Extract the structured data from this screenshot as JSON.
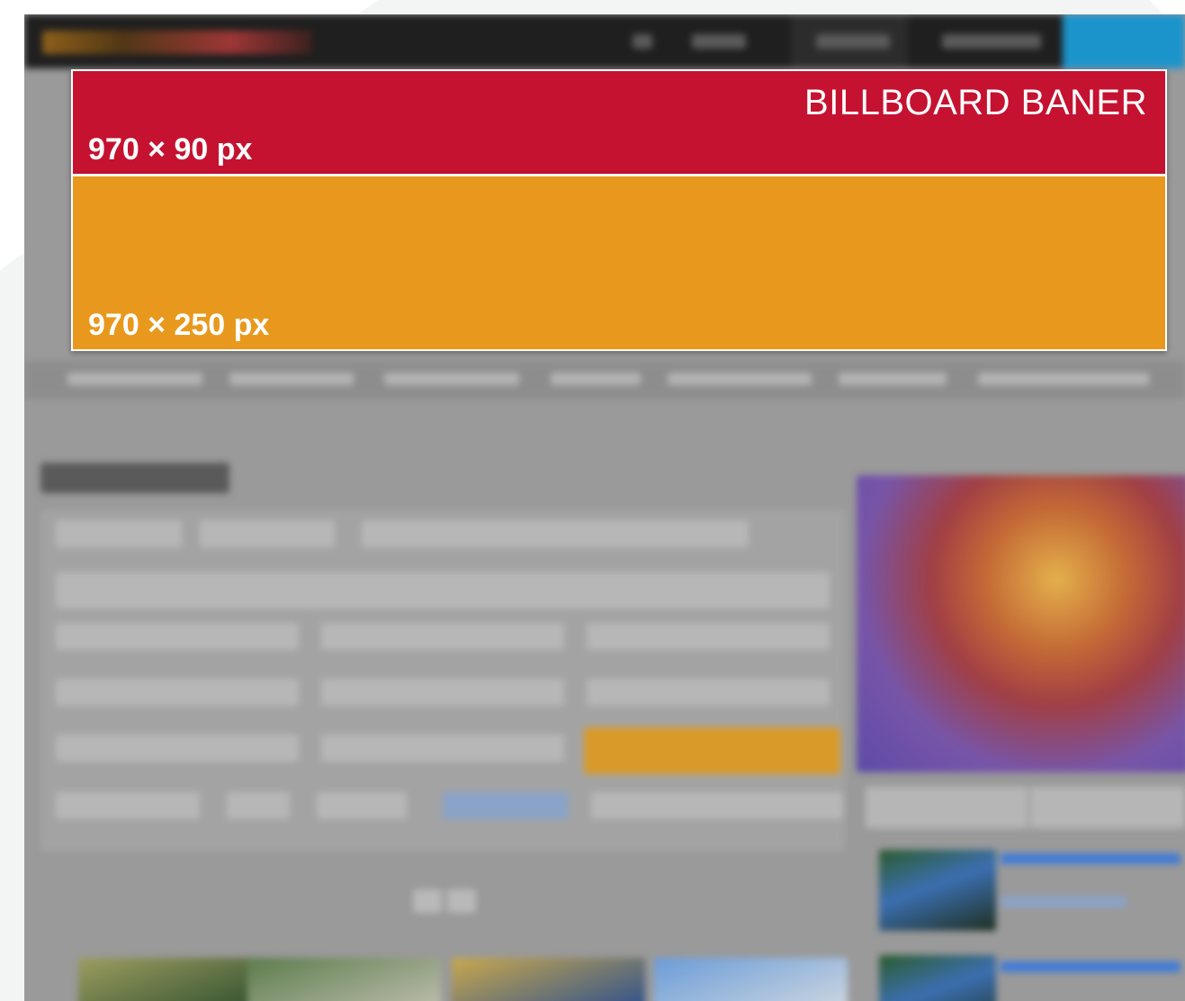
{
  "ad_overlay": {
    "billboard": {
      "title": "BILLBOARD BANER",
      "size": "970 × 90 px",
      "color": "#c41230"
    },
    "large": {
      "size": "970 × 250 px",
      "color": "#e8991d"
    }
  }
}
